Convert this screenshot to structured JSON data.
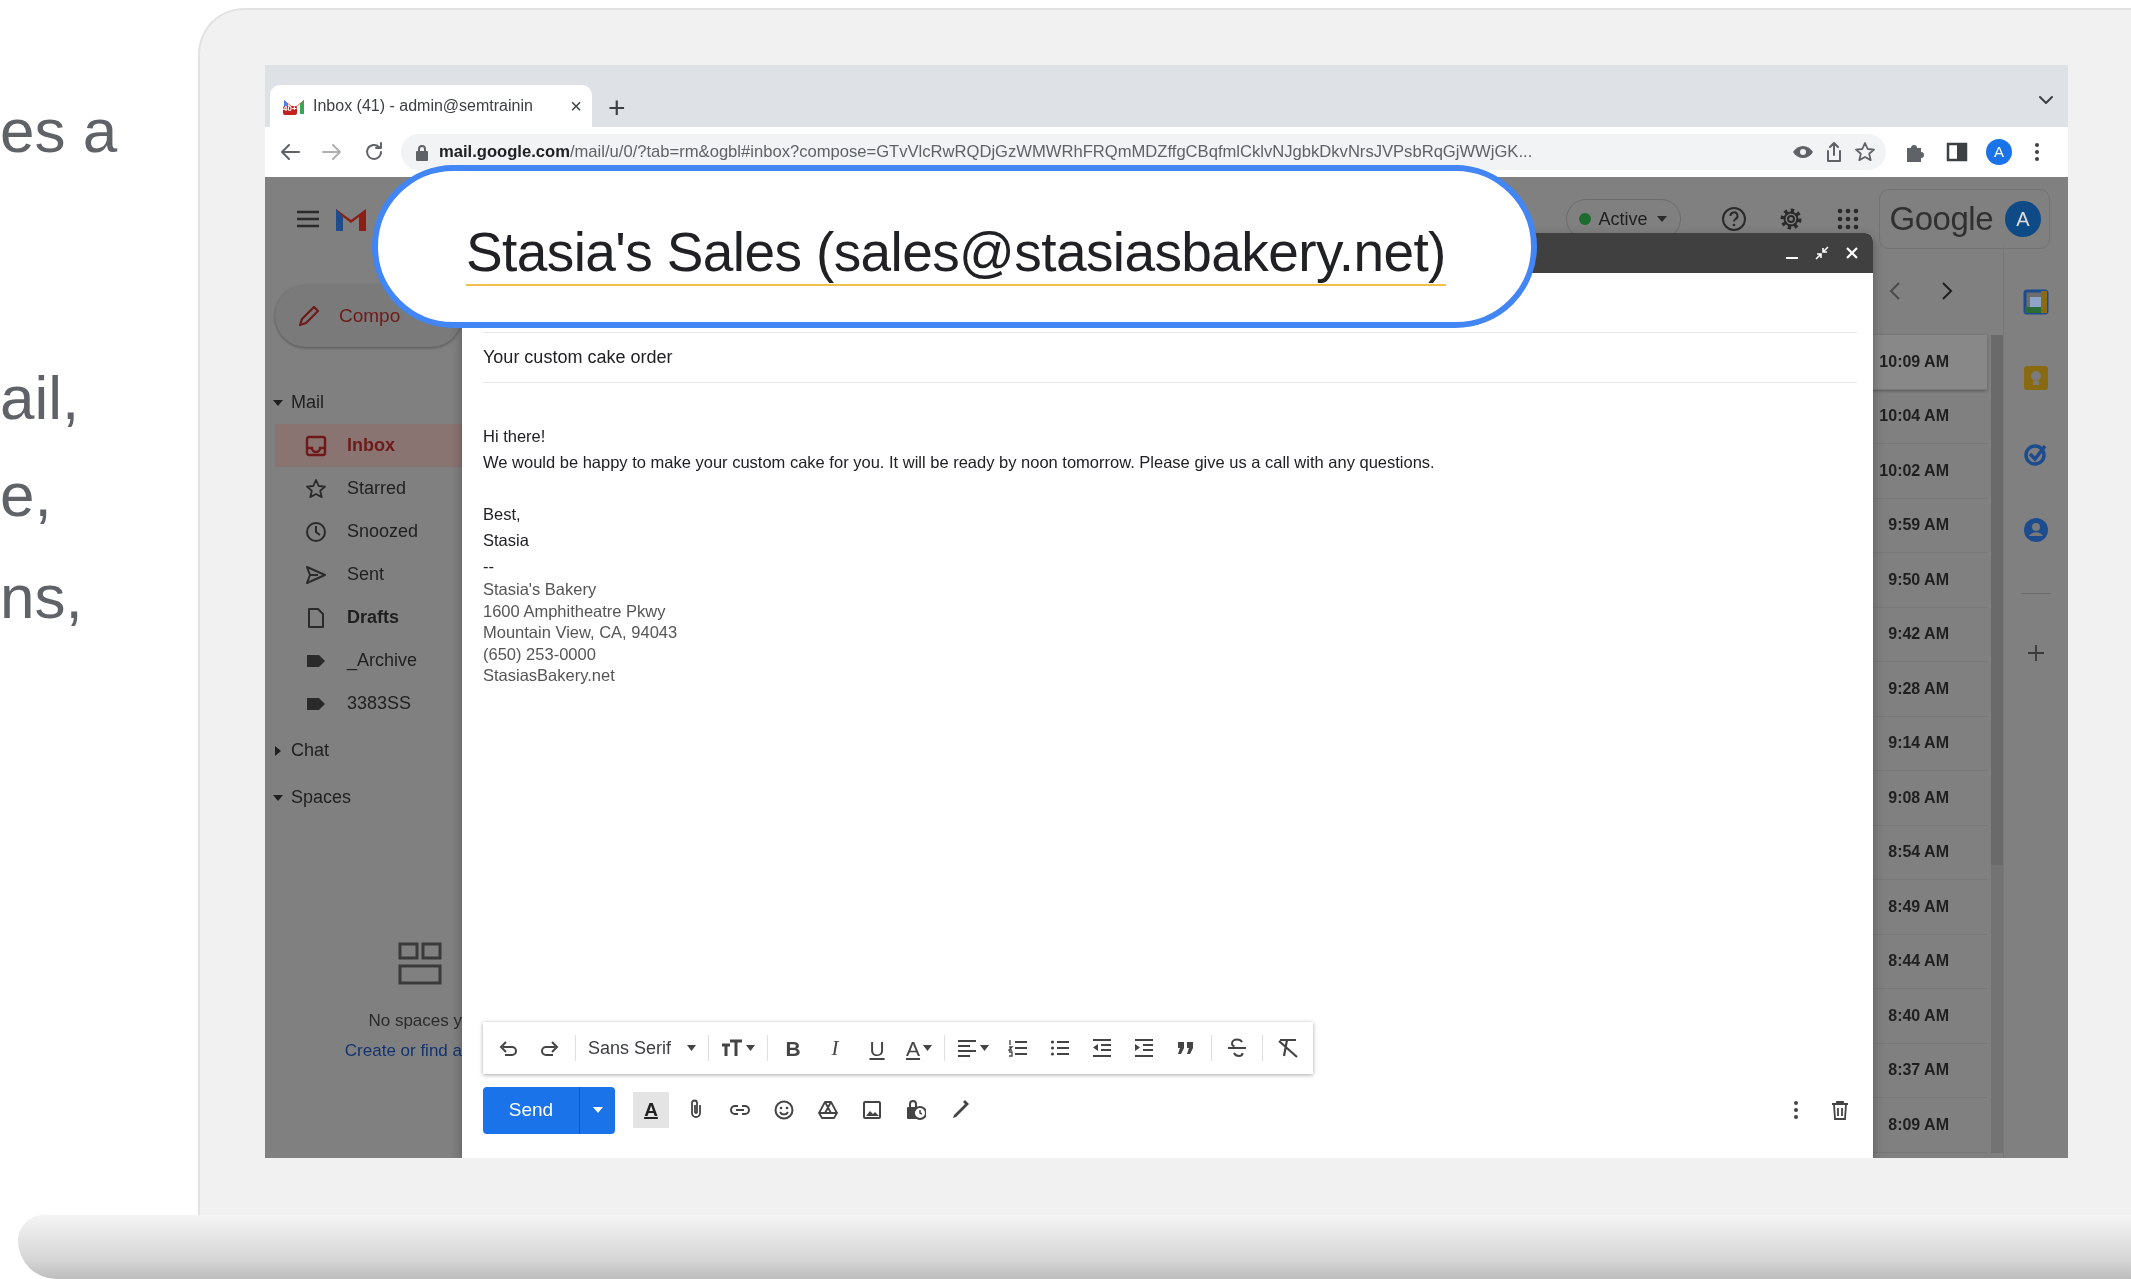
{
  "side_text": [
    "es a",
    "ail,",
    "e,",
    "ns,"
  ],
  "browser": {
    "tab": {
      "title": "Inbox (41) - admin@semtrainin",
      "badge": "40+",
      "close": "×"
    },
    "new_tab": "+",
    "url": {
      "host": "mail.google.com",
      "path": "/mail/u/0/?tab=rm&ogbl#inbox?compose=GTvVlcRwRQDjGzWMWRhFRQmMDZffgCBqfmlCklvNJgbkDkvNrsJVPsbRqGjWWjGK..."
    },
    "profile_initial": "A"
  },
  "gmail": {
    "compose_button": "Compo",
    "sections": [
      {
        "label": "Mail",
        "expanded": true,
        "items": [
          {
            "label": "Inbox",
            "selected": true,
            "unread": true
          },
          {
            "label": "Starred",
            "selected": false,
            "unread": false
          },
          {
            "label": "Snoozed",
            "selected": false,
            "unread": false
          },
          {
            "label": "Sent",
            "selected": false,
            "unread": false
          },
          {
            "label": "Drafts",
            "selected": false,
            "unread": true
          },
          {
            "label": "_Archive",
            "selected": false,
            "unread": false
          },
          {
            "label": "3383SS",
            "selected": false,
            "unread": false
          }
        ]
      },
      {
        "label": "Chat",
        "expanded": false
      },
      {
        "label": "Spaces",
        "expanded": true
      }
    ],
    "spaces_empty": {
      "text": "No spaces y",
      "link": "Create or find a"
    },
    "status": "Active",
    "brand": "Google",
    "account_initial": "A",
    "times": [
      "10:09 AM",
      "10:04 AM",
      "10:02 AM",
      "9:59 AM",
      "9:50 AM",
      "9:42 AM",
      "9:28 AM",
      "9:14 AM",
      "9:08 AM",
      "8:54 AM",
      "8:49 AM",
      "8:44 AM",
      "8:40 AM",
      "8:37 AM",
      "8:09 AM"
    ]
  },
  "compose": {
    "from": "Stasia's Sales (sales@stasiasbakery.net)",
    "subject": "Your custom cake order",
    "paragraphs": [
      [
        "Hi there!",
        "We would be happy to make your custom cake for you. It will be ready by noon tomorrow. Please give us a call with any questions."
      ],
      [
        "Best,",
        "Stasia"
      ]
    ],
    "signature_separator": "--",
    "signature": [
      "Stasia's Bakery",
      "1600 Amphitheatre Pkwy",
      "Mountain View, CA, 94043",
      "(650) 253-0000",
      "StasiasBakery.net"
    ],
    "toolbar": {
      "font": "Sans Serif",
      "bold": "B",
      "italic": "I",
      "underline": "U",
      "text_color": "A"
    },
    "send": "Send",
    "formatting_toggle": {
      "label": "A",
      "selected": true
    }
  }
}
